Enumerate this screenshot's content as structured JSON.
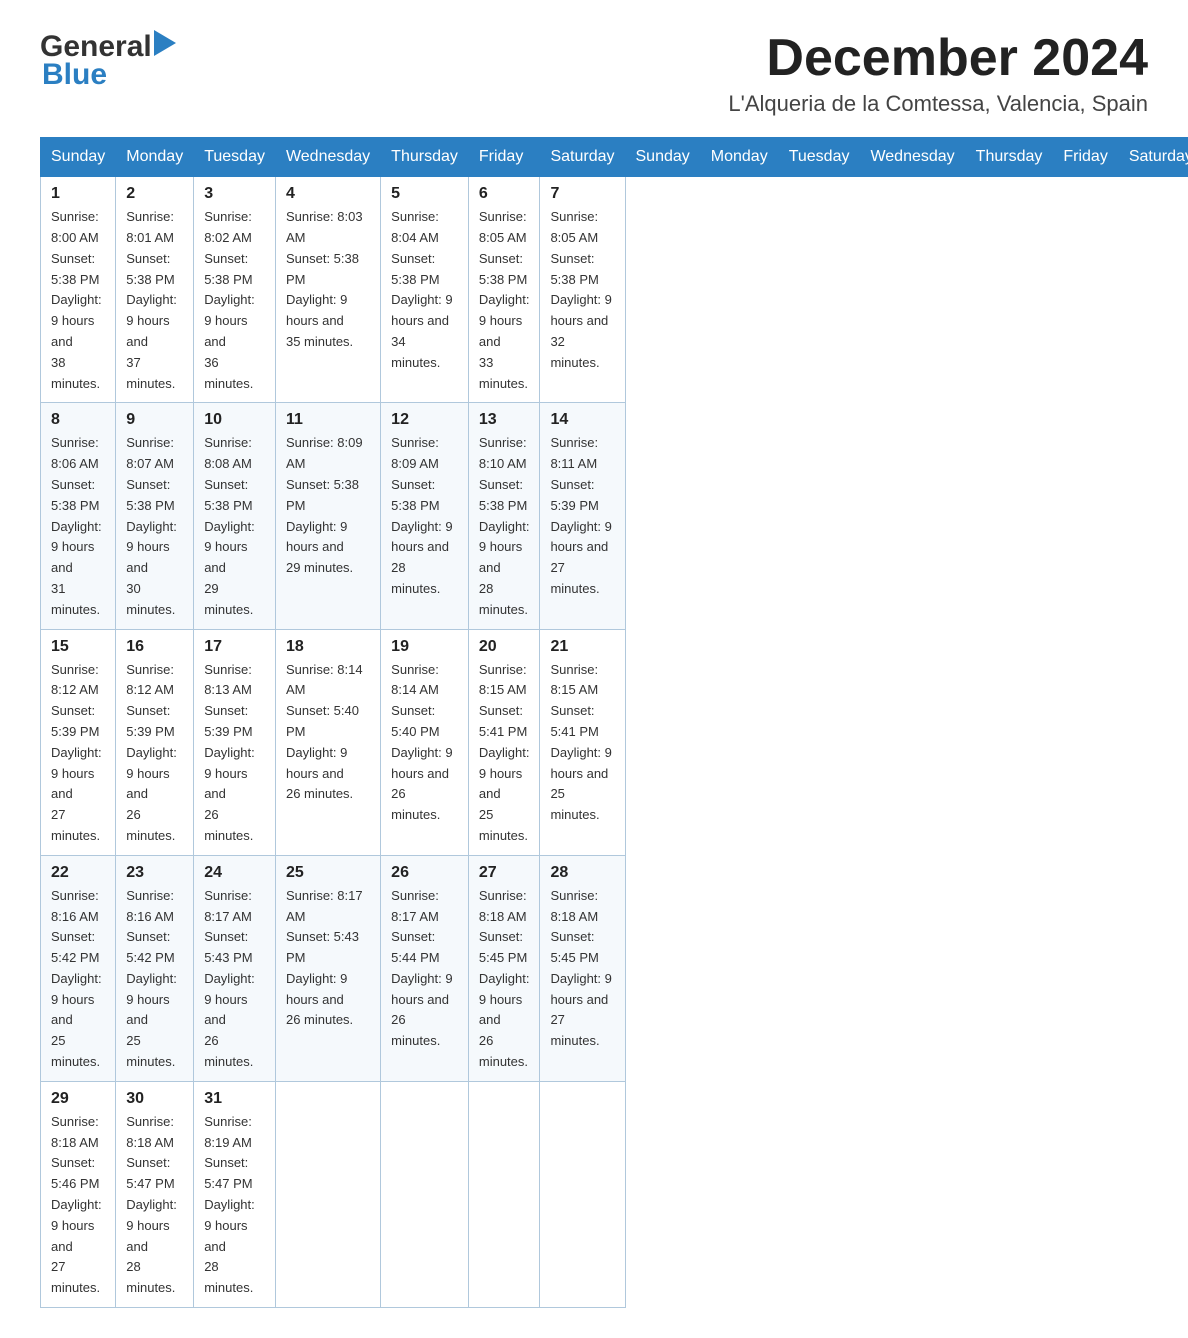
{
  "header": {
    "logo_general": "General",
    "logo_blue": "Blue",
    "month_title": "December 2024",
    "location": "L'Alqueria de la Comtessa, Valencia, Spain"
  },
  "days_of_week": [
    "Sunday",
    "Monday",
    "Tuesday",
    "Wednesday",
    "Thursday",
    "Friday",
    "Saturday"
  ],
  "weeks": [
    [
      {
        "day": "1",
        "sunrise": "8:00 AM",
        "sunset": "5:38 PM",
        "daylight": "9 hours and 38 minutes."
      },
      {
        "day": "2",
        "sunrise": "8:01 AM",
        "sunset": "5:38 PM",
        "daylight": "9 hours and 37 minutes."
      },
      {
        "day": "3",
        "sunrise": "8:02 AM",
        "sunset": "5:38 PM",
        "daylight": "9 hours and 36 minutes."
      },
      {
        "day": "4",
        "sunrise": "8:03 AM",
        "sunset": "5:38 PM",
        "daylight": "9 hours and 35 minutes."
      },
      {
        "day": "5",
        "sunrise": "8:04 AM",
        "sunset": "5:38 PM",
        "daylight": "9 hours and 34 minutes."
      },
      {
        "day": "6",
        "sunrise": "8:05 AM",
        "sunset": "5:38 PM",
        "daylight": "9 hours and 33 minutes."
      },
      {
        "day": "7",
        "sunrise": "8:05 AM",
        "sunset": "5:38 PM",
        "daylight": "9 hours and 32 minutes."
      }
    ],
    [
      {
        "day": "8",
        "sunrise": "8:06 AM",
        "sunset": "5:38 PM",
        "daylight": "9 hours and 31 minutes."
      },
      {
        "day": "9",
        "sunrise": "8:07 AM",
        "sunset": "5:38 PM",
        "daylight": "9 hours and 30 minutes."
      },
      {
        "day": "10",
        "sunrise": "8:08 AM",
        "sunset": "5:38 PM",
        "daylight": "9 hours and 29 minutes."
      },
      {
        "day": "11",
        "sunrise": "8:09 AM",
        "sunset": "5:38 PM",
        "daylight": "9 hours and 29 minutes."
      },
      {
        "day": "12",
        "sunrise": "8:09 AM",
        "sunset": "5:38 PM",
        "daylight": "9 hours and 28 minutes."
      },
      {
        "day": "13",
        "sunrise": "8:10 AM",
        "sunset": "5:38 PM",
        "daylight": "9 hours and 28 minutes."
      },
      {
        "day": "14",
        "sunrise": "8:11 AM",
        "sunset": "5:39 PM",
        "daylight": "9 hours and 27 minutes."
      }
    ],
    [
      {
        "day": "15",
        "sunrise": "8:12 AM",
        "sunset": "5:39 PM",
        "daylight": "9 hours and 27 minutes."
      },
      {
        "day": "16",
        "sunrise": "8:12 AM",
        "sunset": "5:39 PM",
        "daylight": "9 hours and 26 minutes."
      },
      {
        "day": "17",
        "sunrise": "8:13 AM",
        "sunset": "5:39 PM",
        "daylight": "9 hours and 26 minutes."
      },
      {
        "day": "18",
        "sunrise": "8:14 AM",
        "sunset": "5:40 PM",
        "daylight": "9 hours and 26 minutes."
      },
      {
        "day": "19",
        "sunrise": "8:14 AM",
        "sunset": "5:40 PM",
        "daylight": "9 hours and 26 minutes."
      },
      {
        "day": "20",
        "sunrise": "8:15 AM",
        "sunset": "5:41 PM",
        "daylight": "9 hours and 25 minutes."
      },
      {
        "day": "21",
        "sunrise": "8:15 AM",
        "sunset": "5:41 PM",
        "daylight": "9 hours and 25 minutes."
      }
    ],
    [
      {
        "day": "22",
        "sunrise": "8:16 AM",
        "sunset": "5:42 PM",
        "daylight": "9 hours and 25 minutes."
      },
      {
        "day": "23",
        "sunrise": "8:16 AM",
        "sunset": "5:42 PM",
        "daylight": "9 hours and 25 minutes."
      },
      {
        "day": "24",
        "sunrise": "8:17 AM",
        "sunset": "5:43 PM",
        "daylight": "9 hours and 26 minutes."
      },
      {
        "day": "25",
        "sunrise": "8:17 AM",
        "sunset": "5:43 PM",
        "daylight": "9 hours and 26 minutes."
      },
      {
        "day": "26",
        "sunrise": "8:17 AM",
        "sunset": "5:44 PM",
        "daylight": "9 hours and 26 minutes."
      },
      {
        "day": "27",
        "sunrise": "8:18 AM",
        "sunset": "5:45 PM",
        "daylight": "9 hours and 26 minutes."
      },
      {
        "day": "28",
        "sunrise": "8:18 AM",
        "sunset": "5:45 PM",
        "daylight": "9 hours and 27 minutes."
      }
    ],
    [
      {
        "day": "29",
        "sunrise": "8:18 AM",
        "sunset": "5:46 PM",
        "daylight": "9 hours and 27 minutes."
      },
      {
        "day": "30",
        "sunrise": "8:18 AM",
        "sunset": "5:47 PM",
        "daylight": "9 hours and 28 minutes."
      },
      {
        "day": "31",
        "sunrise": "8:19 AM",
        "sunset": "5:47 PM",
        "daylight": "9 hours and 28 minutes."
      },
      null,
      null,
      null,
      null
    ]
  ]
}
